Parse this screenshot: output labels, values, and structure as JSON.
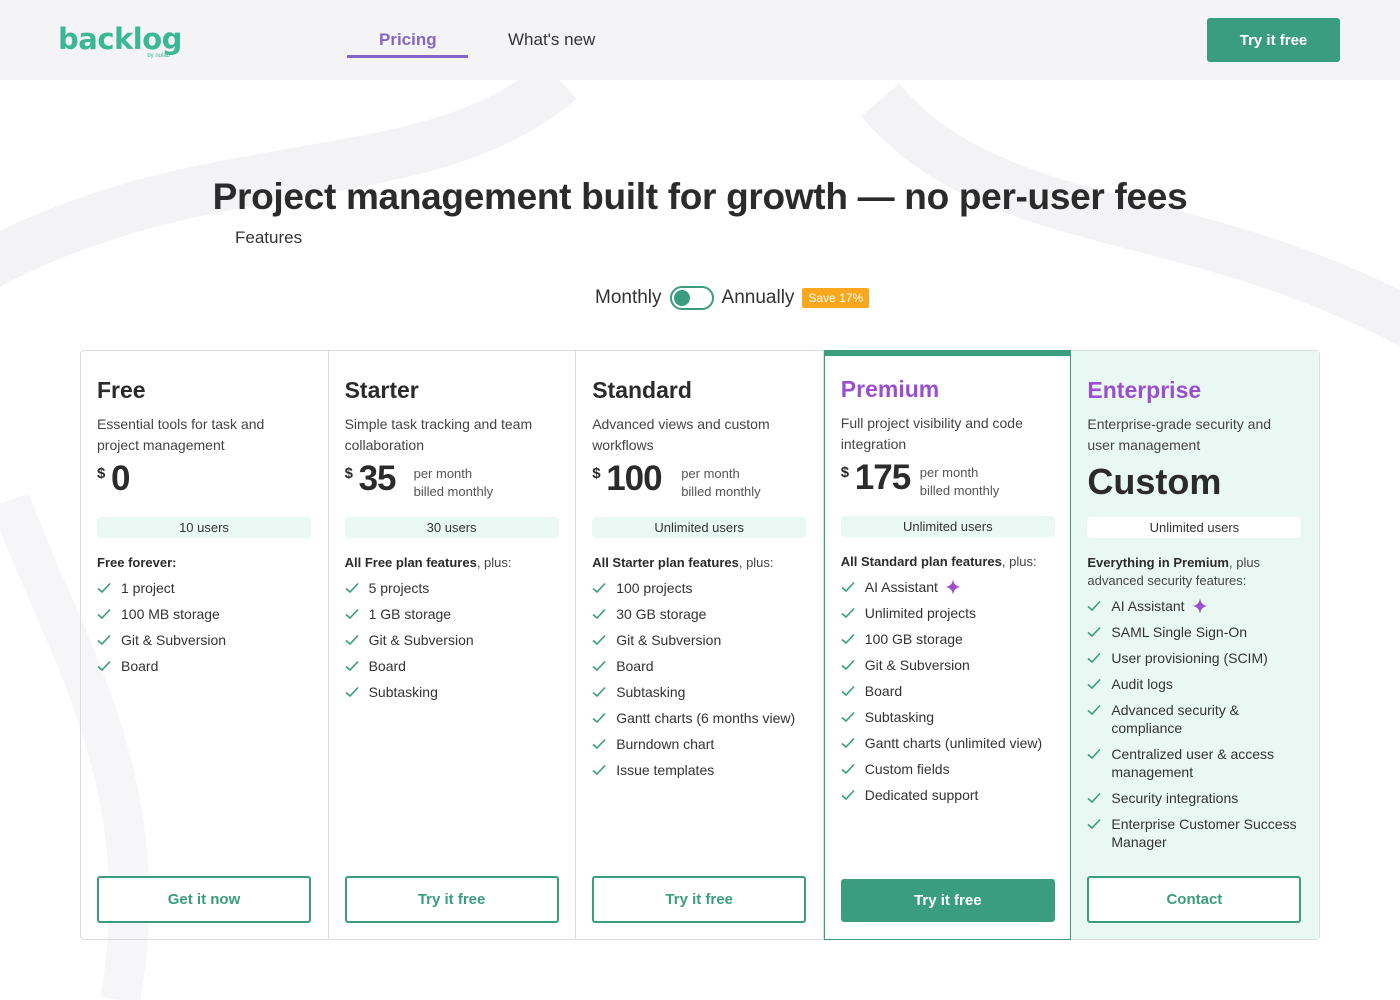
{
  "nav": {
    "logo_text": "backlog",
    "logo_sub": "by nulab",
    "links": [
      "Features",
      "Pricing",
      "What's new"
    ],
    "active_link": "Pricing",
    "cta": "Try it free"
  },
  "hero": {
    "title": "Project management built for growth — no per-user fees"
  },
  "billing": {
    "monthly": "Monthly",
    "annually": "Annually",
    "save_badge": "Save 17%",
    "toggle_state": "Monthly"
  },
  "colors": {
    "brand_green": "#3a9d7d",
    "accent_purple": "#8566c8",
    "premium_purple": "#9b4fd0",
    "badge_orange": "#f9a81b"
  },
  "plans": [
    {
      "name": "Free",
      "description": "Essential tools for task and project management",
      "currency": "$",
      "price": "0",
      "users": "10 users",
      "features_lead": "Free forever:",
      "features_rest": "",
      "features": [
        "1 project",
        "100 MB storage",
        "Git & Subversion",
        "Board"
      ],
      "button": "Get it now"
    },
    {
      "name": "Starter",
      "description": "Simple task tracking and team collaboration",
      "currency": "$",
      "price": "35",
      "per": "per month",
      "billed": "billed monthly",
      "users": "30 users",
      "features_lead": "All Free plan features",
      "features_rest": ", plus:",
      "features": [
        "5 projects",
        "1 GB storage",
        "Git & Subversion",
        "Board",
        "Subtasking"
      ],
      "button": "Try it free"
    },
    {
      "name": "Standard",
      "description": "Advanced views and custom workflows",
      "currency": "$",
      "price": "100",
      "per": "per month",
      "billed": "billed monthly",
      "users": "Unlimited users",
      "features_lead": "All Starter plan features",
      "features_rest": ", plus:",
      "features": [
        "100 projects",
        "30 GB storage",
        "Git & Subversion",
        "Board",
        "Subtasking",
        "Gantt charts (6 months view)",
        "Burndown chart",
        "Issue templates"
      ],
      "button": "Try it free"
    },
    {
      "name": "Premium",
      "description": "Full project visibility and code integration",
      "currency": "$",
      "price": "175",
      "per": "per month",
      "billed": "billed monthly",
      "users": "Unlimited users",
      "features_lead": "All Standard plan features",
      "features_rest": ", plus:",
      "features": [
        "AI Assistant",
        "Unlimited projects",
        "100 GB storage",
        "Git & Subversion",
        "Board",
        "Subtasking",
        "Gantt charts (unlimited view)",
        "Custom fields",
        "Dedicated support"
      ],
      "button": "Try it free"
    },
    {
      "name": "Enterprise",
      "description": "Enterprise-grade security and user management",
      "price_text": "Custom",
      "users": "Unlimited users",
      "features_lead": "Everything in Premium",
      "features_rest": ", plus advanced security features:",
      "features": [
        "AI Assistant",
        "SAML Single Sign-On",
        "User provisioning (SCIM)",
        "Audit logs",
        "Advanced security & compliance",
        "Centralized user & access management",
        "Security integrations",
        "Enterprise Customer Success Manager"
      ],
      "button": "Contact"
    }
  ]
}
